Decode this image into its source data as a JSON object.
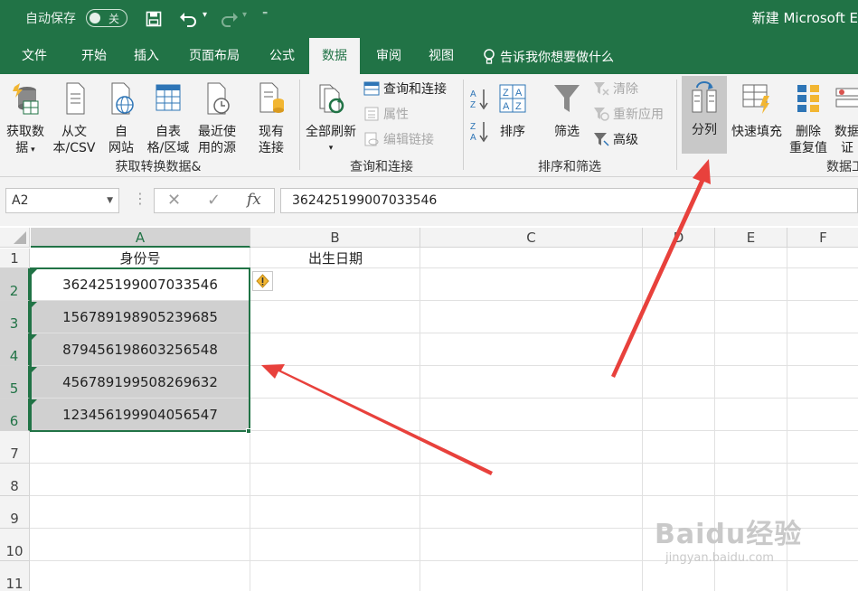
{
  "titlebar": {
    "autosave_label": "自动保存",
    "autosave_state": "关",
    "window_title": "新建 Microsoft E"
  },
  "tabs": [
    "文件",
    "开始",
    "插入",
    "页面布局",
    "公式",
    "数据",
    "审阅",
    "视图"
  ],
  "active_tab": "数据",
  "tell_me": "告诉我你想要做什么",
  "ribbon": {
    "get_data": [
      "获取数",
      "据"
    ],
    "from_csv": [
      "从文",
      "本/CSV"
    ],
    "from_web": [
      "自",
      "网站"
    ],
    "from_table": [
      "自表",
      "格/区域"
    ],
    "recent_sources": [
      "最近使",
      "用的源"
    ],
    "existing_conn": [
      "现有",
      "连接"
    ],
    "group1": "获取转换数据&",
    "refresh_all": "全部刷新",
    "queries_connections": "查询和连接",
    "properties": "属性",
    "edit_links": "编辑链接",
    "group2": "查询和连接",
    "sort": "排序",
    "filter": "筛选",
    "clear": "清除",
    "reapply": "重新应用",
    "advanced": "高级",
    "group3": "排序和筛选",
    "text_to_columns": "分列",
    "flash_fill": "快速填充",
    "remove_duplicates": [
      "删除",
      "重复值"
    ],
    "data_validation": [
      "数据",
      "证"
    ],
    "group4": "数据工"
  },
  "formula_bar": {
    "name_box": "A2",
    "cancel": "✕",
    "enter": "✓",
    "fx": "fx",
    "value": "362425199007033546"
  },
  "columns": [
    "A",
    "B",
    "C",
    "D",
    "E",
    "F"
  ],
  "rows": [
    "1",
    "2",
    "3",
    "4",
    "5",
    "6",
    "7",
    "8",
    "9",
    "10",
    "11"
  ],
  "sheet": {
    "A1": "身份号",
    "B1": "出生日期",
    "A_values": [
      "362425199007033546",
      "156789198905239685",
      "879456198603256548",
      "456789199508269632",
      "123456199904056547"
    ]
  },
  "warning_icon": "warning-icon",
  "watermark": {
    "main": "Baidu经验",
    "url": "jingyan.baidu.com"
  },
  "colors": {
    "excel_green": "#217346",
    "arrow_red": "#e8413c",
    "selected_fill": "#d0d0d0"
  }
}
